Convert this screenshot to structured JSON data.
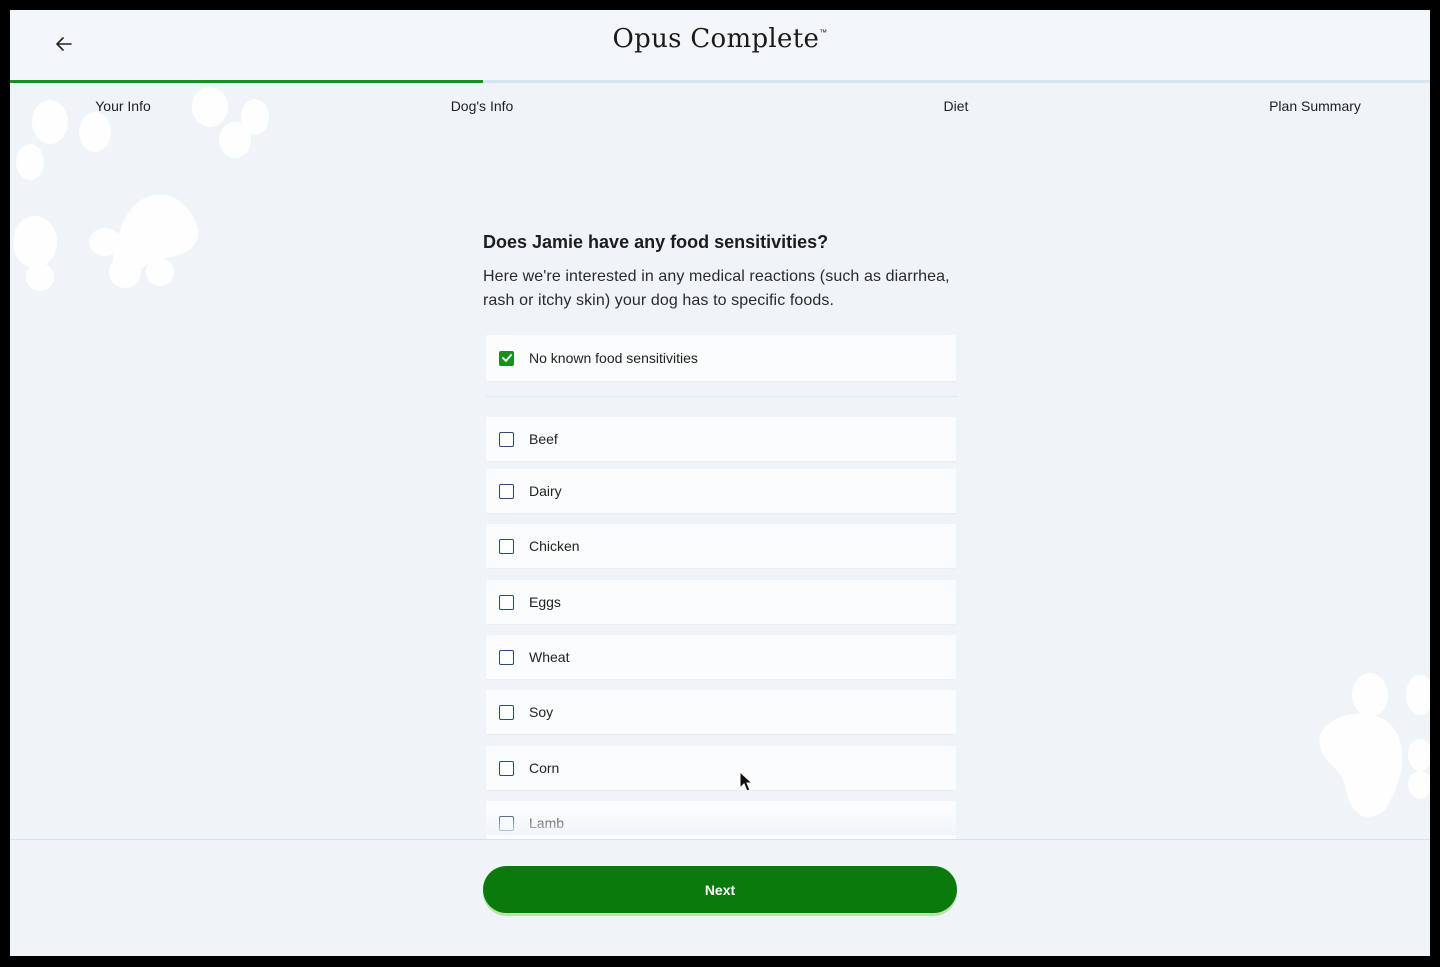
{
  "brand": {
    "logo_text": "Opus Complete",
    "trademark": "™"
  },
  "header": {
    "back_icon": "arrow-left-icon"
  },
  "progress": {
    "fraction": 0.333,
    "fill_color": "#16911c",
    "track_color": "#d4e5f1",
    "steps": [
      {
        "label": "Your Info"
      },
      {
        "label": "Dog's Info"
      },
      {
        "label": "Diet"
      },
      {
        "label": "Plan Summary"
      }
    ]
  },
  "question": {
    "title": "Does Jamie have any food sensitivities?",
    "description": "Here we're interested in any medical reactions (such as diarrhea, rash or itchy skin) your dog has to specific foods."
  },
  "no_sensitivities": {
    "label": "No known food sensitivities",
    "checked": true
  },
  "options": [
    {
      "label": "Beef",
      "checked": false
    },
    {
      "label": "Dairy",
      "checked": false
    },
    {
      "label": "Chicken",
      "checked": false
    },
    {
      "label": "Eggs",
      "checked": false
    },
    {
      "label": "Wheat",
      "checked": false
    },
    {
      "label": "Soy",
      "checked": false
    },
    {
      "label": "Corn",
      "checked": false
    },
    {
      "label": "Lamb",
      "checked": false
    }
  ],
  "footer": {
    "next_label": "Next"
  },
  "colors": {
    "accent": "#16911c",
    "button": "#0b7a0d",
    "background": "#eff4f8"
  }
}
